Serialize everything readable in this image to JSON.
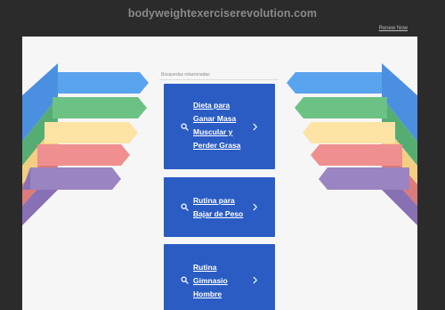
{
  "header": {
    "domain": "bodyweightexerciserevolution.com",
    "renew_link": "Renew Now"
  },
  "related": {
    "title": "Búsquedas relacionadas",
    "items": [
      {
        "label_lines": [
          "Dieta para",
          "Ganar Masa",
          "Muscular y",
          "Perder Grasa"
        ]
      },
      {
        "label_lines": [
          "Rutina para",
          "Bajar de Peso"
        ]
      },
      {
        "label_lines": [
          "Rutina",
          "Gimnasio",
          "Hombre"
        ]
      }
    ]
  },
  "colors": {
    "background": "#2b2b2b",
    "panel": "#f6f6f6",
    "card": "#2a5cc4",
    "stripes": [
      "#5aa3ef",
      "#6cc184",
      "#fde3a4",
      "#ef8f8f",
      "#9b84c2"
    ]
  },
  "icons": {
    "search": "search-icon",
    "chevron": "chevron-right-icon"
  }
}
